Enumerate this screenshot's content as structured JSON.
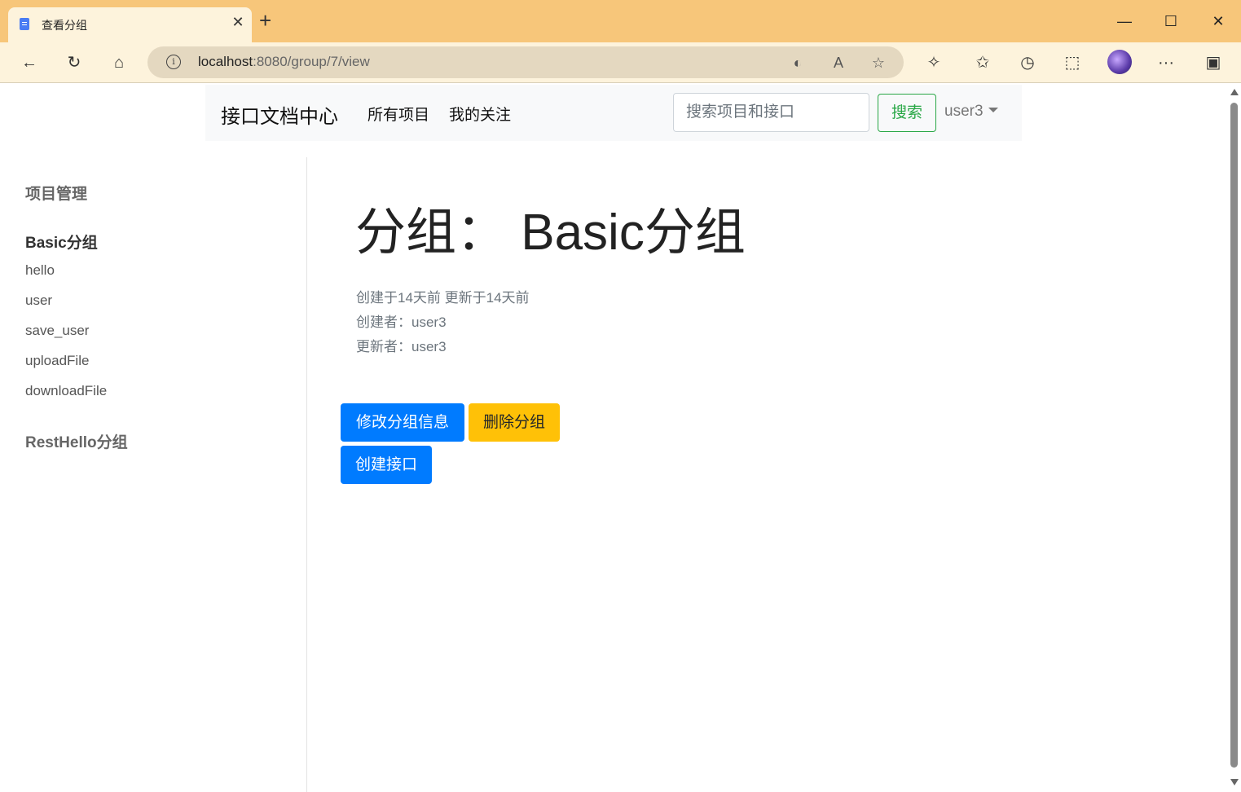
{
  "browser": {
    "tab_title": "查看分组",
    "url_host": "localhost",
    "url_rest": ":8080/group/7/view"
  },
  "navbar": {
    "brand": "接口文档中心",
    "links": [
      "所有项目",
      "我的关注"
    ],
    "search_placeholder": "搜索项目和接口",
    "search_button": "搜索",
    "user": "user3"
  },
  "sidebar": {
    "heading": "项目管理",
    "groups": [
      {
        "name": "Basic分组",
        "items": [
          "hello",
          "user",
          "save_user",
          "uploadFile",
          "downloadFile"
        ]
      },
      {
        "name": "RestHello分组",
        "items": []
      }
    ]
  },
  "main": {
    "title": "分组：  Basic分组",
    "times": "创建于14天前 更新于14天前",
    "creator": "创建者：user3",
    "updater": "更新者：user3",
    "buttons": {
      "edit": "修改分组信息",
      "delete": "删除分组",
      "create_api": "创建接口"
    }
  },
  "colors": {
    "primary": "#007bff",
    "warning": "#ffc107",
    "success": "#28a745",
    "titlebar": "#f7c67a"
  }
}
